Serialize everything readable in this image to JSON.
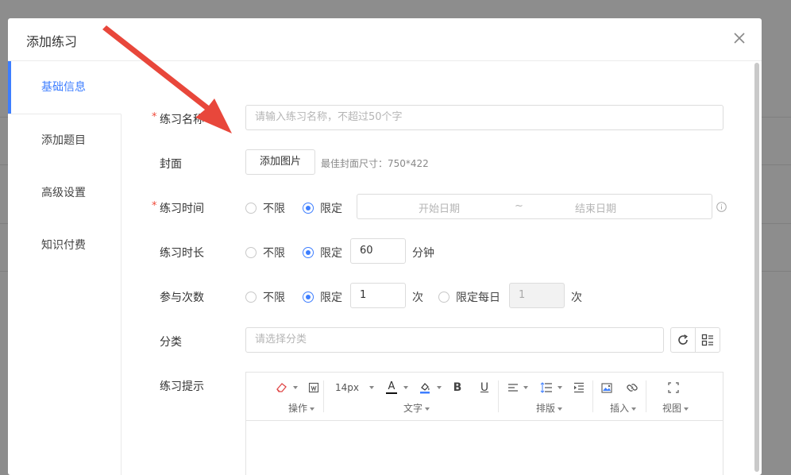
{
  "modal": {
    "title": "添加练习",
    "close_symbol": "×"
  },
  "nav": {
    "items": [
      {
        "label": "基础信息",
        "active": true
      },
      {
        "label": "添加题目",
        "active": false
      },
      {
        "label": "高级设置",
        "active": false
      },
      {
        "label": "知识付费",
        "active": false
      }
    ]
  },
  "form": {
    "name": {
      "label": "练习名称",
      "required_mark": "*",
      "placeholder": "请输入练习名称，不超过50个字"
    },
    "cover": {
      "label": "封面",
      "button": "添加图片",
      "hint": "最佳封面尺寸：750*422"
    },
    "time": {
      "label": "练习时间",
      "required_mark": "*",
      "option_unlimited": "不限",
      "option_limited": "限定",
      "selected": "限定",
      "start_placeholder": "开始日期",
      "separator": "~",
      "end_placeholder": "结束日期"
    },
    "duration": {
      "label": "练习时长",
      "option_unlimited": "不限",
      "option_limited": "限定",
      "selected": "限定",
      "value": "60",
      "unit": "分钟"
    },
    "attempts": {
      "label": "参与次数",
      "option_unlimited": "不限",
      "option_limited": "限定",
      "selected": "限定",
      "value": "1",
      "unit": "次",
      "option_daily": "限定每日",
      "daily_value": "1",
      "daily_unit": "次"
    },
    "category": {
      "label": "分类",
      "placeholder": "请选择分类"
    },
    "tips": {
      "label": "练习提示"
    }
  },
  "editor": {
    "font_size": "14px",
    "groups": {
      "operation": "操作",
      "text": "文字",
      "layout": "排版",
      "insert": "插入",
      "view": "视图"
    },
    "bold_glyph": "B",
    "underline_glyph": "U",
    "font_color_glyph": "A"
  },
  "colors": {
    "accent": "#3d7eff",
    "required": "#f04a3a",
    "arrow": "#e8473b"
  }
}
